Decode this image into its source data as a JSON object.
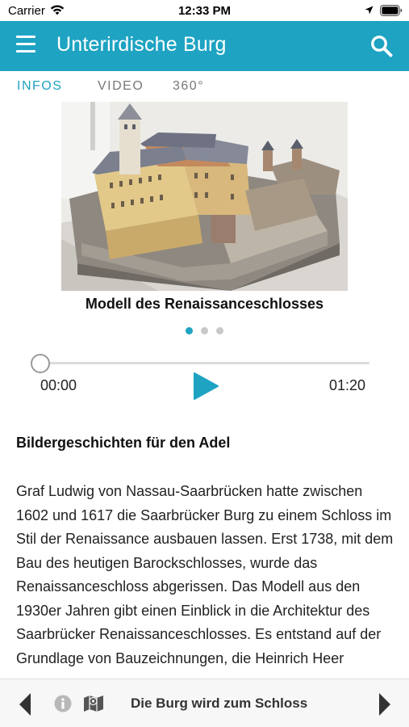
{
  "status_bar": {
    "carrier": "Carrier",
    "time": "12:33 PM",
    "icons": [
      "wifi-icon",
      "location-icon",
      "battery-icon"
    ]
  },
  "header": {
    "title": "Unterirdische Burg",
    "icons": [
      "menu-icon",
      "search-icon"
    ]
  },
  "tabs": [
    {
      "label": "INFOS",
      "active": true
    },
    {
      "label": "VIDEO",
      "active": false
    },
    {
      "label": "360°",
      "active": false
    }
  ],
  "carousel": {
    "caption": "Modell des Renaissanceschlosses",
    "slide_count": 3,
    "active_index": 0
  },
  "audio": {
    "current_time": "00:00",
    "total_time": "01:20",
    "progress": 0
  },
  "article": {
    "heading": "Bildergeschichten für den Adel",
    "body": "Graf Ludwig von Nassau-Saarbrücken hatte zwischen 1602 und 1617 die Saarbrücker Burg zu einem Schloss im Stil der Renaissance ausbauen lassen. Erst 1738, mit dem Bau des heutigen Barockschlosses, wurde das Renaissanceschloss abgerissen. Das Modell aus den 1930er Jahren gibt einen Einblick in die Architektur des Saarbrücker Renaissanceschlosses. Es entstand auf der Grundlage von Bauzeichnungen, die Heinrich Heer"
  },
  "bottom_bar": {
    "chapter_title": "Die Burg wird zum Schloss",
    "icons": [
      "chevron-left-icon",
      "info-icon",
      "map-icon",
      "chevron-right-icon"
    ]
  },
  "colors": {
    "accent": "#1ea3c2",
    "header_text": "#ffffff",
    "inactive_tab": "#777777",
    "bottom_bar_bg": "#f7f7f7"
  }
}
